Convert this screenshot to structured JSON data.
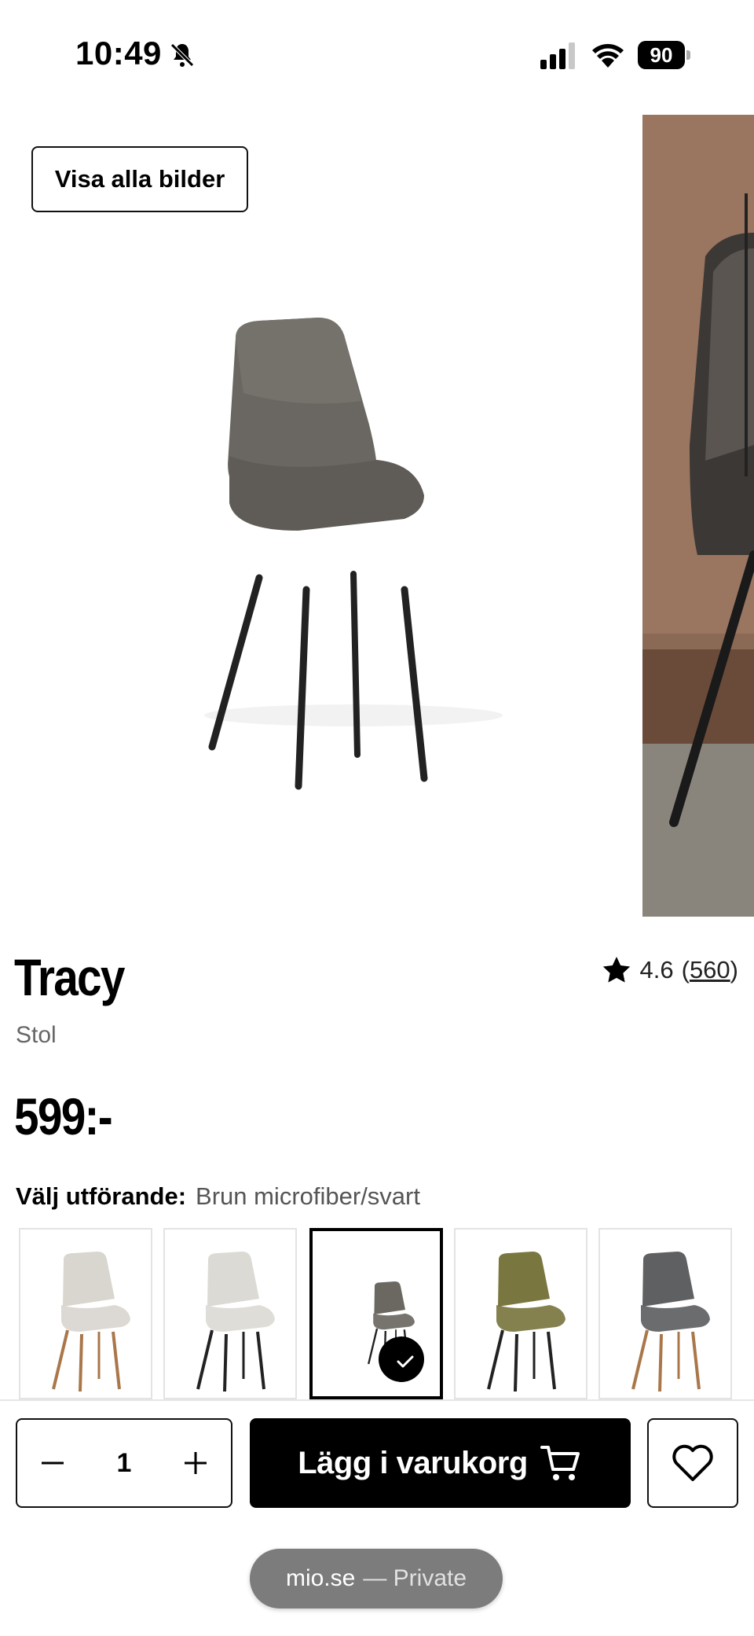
{
  "status_bar": {
    "time": "10:49",
    "battery": "90",
    "icons": [
      "bell-slash-icon",
      "cellular-signal-icon",
      "wifi-icon",
      "battery-icon"
    ]
  },
  "gallery": {
    "show_all_label": "Visa alla bilder"
  },
  "product": {
    "title": "Tracy",
    "type": "Stol",
    "rating": "4.6",
    "rating_count": "560",
    "price": "599:-"
  },
  "variants": {
    "label": "Välj utförande:",
    "selected_value": "Brun microfiber/svart",
    "options": [
      {
        "seat_color": "#d9d6d0",
        "leg_color": "#a9774a",
        "selected": false
      },
      {
        "seat_color": "#dcdad5",
        "leg_color": "#222222",
        "selected": false
      },
      {
        "seat_color": "#6b6862",
        "leg_color": "#222222",
        "selected": true
      },
      {
        "seat_color": "#7a7640",
        "leg_color": "#222222",
        "selected": false
      },
      {
        "seat_color": "#5e6062",
        "leg_color": "#a9774a",
        "selected": false
      }
    ]
  },
  "actions": {
    "quantity": "1",
    "add_to_cart_label": "Lägg i varukorg"
  },
  "browser": {
    "domain": "mio.se",
    "mode": "— Private"
  }
}
